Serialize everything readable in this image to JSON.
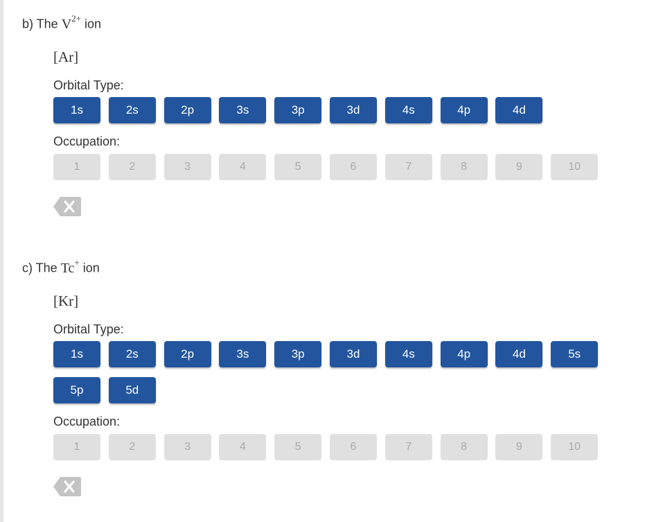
{
  "part_b": {
    "prefix": "b) The",
    "ion_symbol": "V",
    "ion_charge": "2+",
    "suffix": "ion",
    "config": "[Ar]",
    "orbital_label": "Orbital Type:",
    "orbitals": [
      "1s",
      "2s",
      "2p",
      "3s",
      "3p",
      "3d",
      "4s",
      "4p",
      "4d"
    ],
    "occupation_label": "Occupation:",
    "occupations": [
      "1",
      "2",
      "3",
      "4",
      "5",
      "6",
      "7",
      "8",
      "9",
      "10"
    ],
    "clear_icon": "backspace-icon"
  },
  "part_c": {
    "prefix": "c) The",
    "ion_symbol": "Tc",
    "ion_charge": "+",
    "suffix": "ion",
    "config": "[Kr]",
    "orbital_label": "Orbital Type:",
    "orbitals": [
      "1s",
      "2s",
      "2p",
      "3s",
      "3p",
      "3d",
      "4s",
      "4p",
      "4d",
      "5s",
      "5p",
      "5d"
    ],
    "occupation_label": "Occupation:",
    "occupations": [
      "1",
      "2",
      "3",
      "4",
      "5",
      "6",
      "7",
      "8",
      "9",
      "10"
    ],
    "clear_icon": "backspace-icon"
  },
  "colors": {
    "orbital_button": "#22559e",
    "orbital_text": "#ffffff",
    "occupation_button": "#e0e0e0",
    "occupation_text": "#a9a9a9",
    "clear_icon": "#c4c4c4"
  }
}
